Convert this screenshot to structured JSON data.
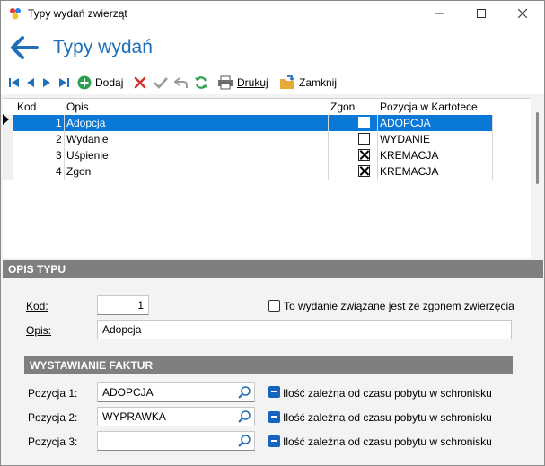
{
  "window": {
    "title": "Typy wydań zwierząt"
  },
  "header": {
    "title": "Typy wydań"
  },
  "toolbar": {
    "add_label": "Dodaj",
    "print_label": "Drukuj",
    "close_label": "Zamknij"
  },
  "grid": {
    "columns": {
      "kod": "Kod",
      "opis": "Opis",
      "zgon": "Zgon",
      "pozycja": "Pozycja w Kartotece"
    },
    "rows": [
      {
        "kod": "1",
        "opis": "Adopcja",
        "zgon": false,
        "pozycja": "ADOPCJA"
      },
      {
        "kod": "2",
        "opis": "Wydanie",
        "zgon": false,
        "pozycja": "WYDANIE"
      },
      {
        "kod": "3",
        "opis": "Uśpienie",
        "zgon": true,
        "pozycja": "KREMACJA"
      },
      {
        "kod": "4",
        "opis": "Zgon",
        "zgon": true,
        "pozycja": "KREMACJA"
      }
    ]
  },
  "opis_typu": {
    "section_title": "OPIS TYPU",
    "kod_label": "Kod:",
    "kod_value": "1",
    "opis_label": "Opis:",
    "opis_value": "Adopcja",
    "death_checkbox_label": "To wydanie związane jest ze zgonem zwierzęcia"
  },
  "faktury": {
    "section_title": "WYSTAWIANIE FAKTUR",
    "rows": [
      {
        "label": "Pozycja 1:",
        "value": "ADOPCJA",
        "option_label": "Ilość zależna od czasu pobytu w schronisku"
      },
      {
        "label": "Pozycja 2:",
        "value": "WYPRAWKA",
        "option_label": "Ilość zależna od czasu pobytu w schronisku"
      },
      {
        "label": "Pozycja 3:",
        "value": "",
        "option_label": "Ilość zależna od czasu pobytu w schronisku"
      }
    ]
  },
  "colors": {
    "accent": "#1f6fb8",
    "selection": "#0a78d7",
    "section": "#7f7f7f"
  }
}
